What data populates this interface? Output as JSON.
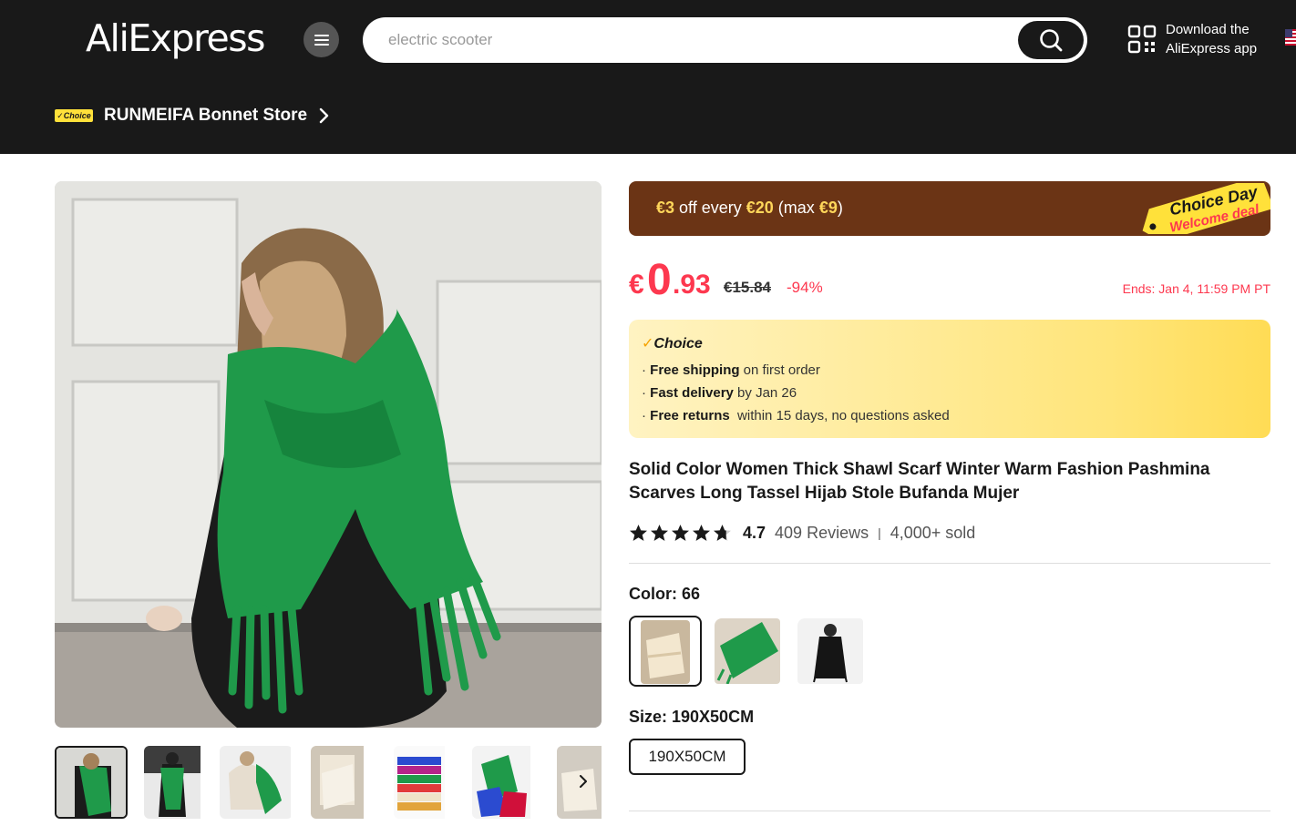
{
  "header": {
    "logo_text": "AliExpress",
    "search_placeholder": "electric scooter",
    "app_line1": "Download the",
    "app_line2": "AliExpress app"
  },
  "store": {
    "badge": "✓Choice",
    "name": "RUNMEIFA Bonnet Store"
  },
  "promo": {
    "amount_off": "€3",
    "text_mid": " off every ",
    "threshold": "€20",
    "text_max_open": " (max ",
    "max": "€9",
    "text_close": ")",
    "tag_line1": "Choice Day",
    "tag_line2": "Welcome deal"
  },
  "price": {
    "currency": "€",
    "integer": "0",
    "decimal": ".93",
    "original": "€15.84",
    "discount": "-94%",
    "ends": "Ends: Jan 4, 11:59 PM PT"
  },
  "choice_box": {
    "title": "Choice",
    "lines": [
      {
        "bold": "Free shipping",
        "rest": " on first order"
      },
      {
        "bold": "Fast delivery",
        "rest": " by Jan 26"
      },
      {
        "bold": "Free returns",
        "rest": "  within 15 days, no questions asked"
      }
    ]
  },
  "product": {
    "title": "Solid Color Women Thick Shawl Scarf Winter Warm Fashion Pashmina Scarves Long Tassel Hijab Stole Bufanda Mujer",
    "rating": "4.7",
    "reviews": "409 Reviews",
    "sold": "4,000+ sold",
    "stars_value": 4.7
  },
  "options": {
    "color_label": "Color: 66",
    "size_label": "Size: 190X50CM",
    "size_value": "190X50CM"
  },
  "colors": {
    "accent_red": "#fd384f",
    "header_bg": "#191919",
    "promo_bg": "#6b3415",
    "scarf_green": "#1f9a4a"
  }
}
